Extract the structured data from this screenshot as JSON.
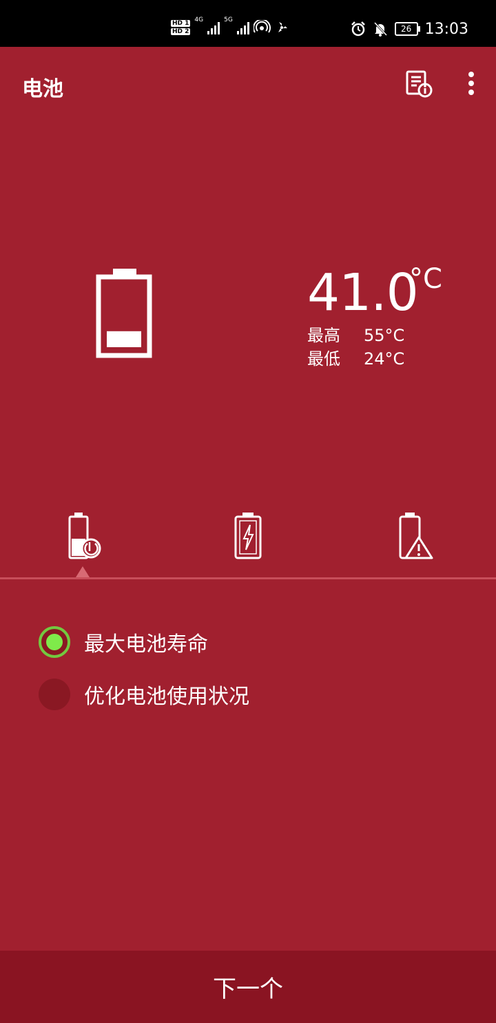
{
  "status_bar": {
    "hd1": "HD 1",
    "hd2": "HD 2",
    "net1": "4G",
    "net2": "5G",
    "battery_level": "26",
    "time": "13:03"
  },
  "app_bar": {
    "title": "电池"
  },
  "temperature": {
    "current": "41.0",
    "unit": "°C",
    "max_label": "最高",
    "max_value": "55°C",
    "min_label": "最低",
    "min_value": "24°C"
  },
  "battery_charge_fraction": 0.2,
  "tabs": [
    {
      "icon": "battery-life-icon",
      "selected": true
    },
    {
      "icon": "battery-charging-icon",
      "selected": false
    },
    {
      "icon": "battery-warning-icon",
      "selected": false
    }
  ],
  "options": [
    {
      "label": "最大电池寿命",
      "selected": true
    },
    {
      "label": "优化电池使用状况",
      "selected": false
    }
  ],
  "colors": {
    "background": "#A1202F",
    "button": "#8A1422",
    "accent_green": "#7FEA4A"
  },
  "next_button": "下一个"
}
